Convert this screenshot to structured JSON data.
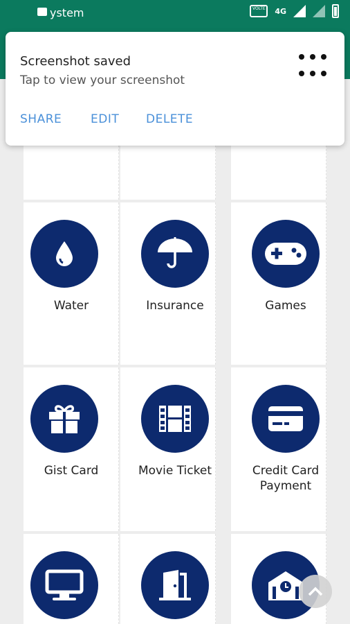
{
  "status_bar": {
    "app_name": "ystem",
    "volte": "VOLTE",
    "network": "4G"
  },
  "notification": {
    "title": "Screenshot saved",
    "subtitle": "Tap to view your screenshot",
    "actions": [
      "SHARE",
      "EDIT",
      "DELETE"
    ]
  },
  "grid": {
    "items": [
      {
        "label": "Water",
        "icon": "water-drop-icon"
      },
      {
        "label": "Insurance",
        "icon": "umbrella-icon"
      },
      {
        "label": "Games",
        "icon": "gamepad-icon"
      },
      {
        "label": "Gist Card",
        "icon": "gift-icon"
      },
      {
        "label": "Movie Ticket",
        "icon": "film-icon"
      },
      {
        "label": "Credit Card",
        "label2": "Payment",
        "icon": "credit-card-icon"
      },
      {
        "label": "",
        "icon": "monitor-icon"
      },
      {
        "label": "",
        "icon": "door-icon"
      },
      {
        "label": "",
        "icon": "building-icon"
      }
    ]
  },
  "colors": {
    "brand": "#0b7a5e",
    "icon_circle": "#0d2a6e",
    "action": "#4a90d9"
  }
}
